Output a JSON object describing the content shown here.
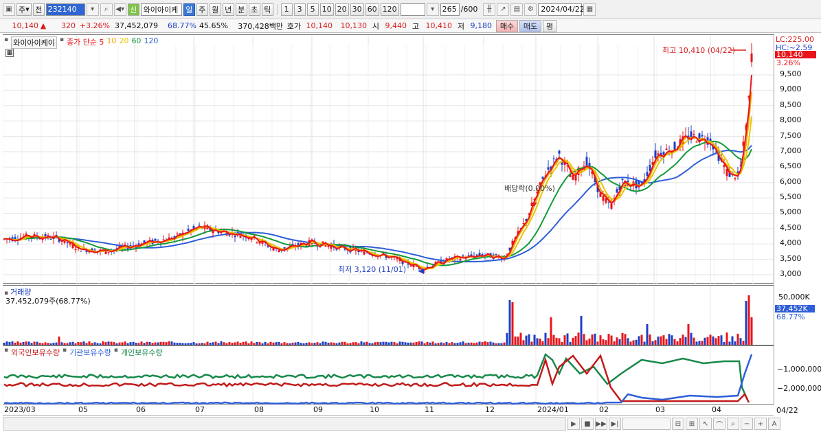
{
  "toolbar": {
    "market_labels": [
      "주",
      "전"
    ],
    "code": "232140",
    "stock_name": "와이아이케",
    "new_badge": "신",
    "periods": [
      "일",
      "주",
      "월",
      "년",
      "분",
      "초",
      "틱"
    ],
    "selected_period": "일",
    "intervals": [
      "1",
      "3",
      "5",
      "10",
      "20",
      "30",
      "60",
      "120"
    ],
    "count": "265",
    "count_total": "/600",
    "date": "2024/04/22"
  },
  "quote": {
    "price": "10,140",
    "arrow": "▲",
    "change": "320",
    "change_pct": "+3.26%",
    "volume": "37,452,079",
    "vol_ratio": "68.77%",
    "turnover": "45.65%",
    "amount": "370,428백만",
    "hoga_label": "호가",
    "ask": "10,140",
    "bid": "10,130",
    "open_label": "시",
    "open": "9,440",
    "high_label": "고",
    "high": "10,410",
    "low_label": "저",
    "low": "9,180",
    "buy": "매수",
    "sell": "매도",
    "eval": "평"
  },
  "price_panel": {
    "name": "와이아이케이",
    "legend": [
      {
        "label": "종가 단순 5",
        "color": "#e8141a"
      },
      {
        "label": "10",
        "color": "#f0a400"
      },
      {
        "label": "20",
        "color": "#e8c400"
      },
      {
        "label": "60",
        "color": "#129a3a"
      },
      {
        "label": "120",
        "color": "#2e5ed8"
      }
    ],
    "high_annotation": "최고 10,410 (04/22)",
    "low_annotation": "최저 3,120 (11/01)",
    "dividend_annotation": "배당락(0.00%)",
    "axis_top": "LC:225.00",
    "axis_top2": "HC:~2.59",
    "price_tag": "10,140",
    "pct_tag": "3.26%",
    "y_ticks": [
      "9,500",
      "9,000",
      "8,500",
      "8,000",
      "7,500",
      "7,000",
      "6,500",
      "6,000",
      "5,500",
      "5,000",
      "4,500",
      "4,000",
      "3,500",
      "3,000"
    ]
  },
  "volume_panel": {
    "title": "거래량",
    "value": "37,452,079주(68.77%)",
    "axis_tag": "37,452K",
    "axis_tag2": "68.77%",
    "y_tick": "50,000K"
  },
  "holding_panel": {
    "legend": [
      {
        "label": "외국인보유수량",
        "color": "#c21a1a"
      },
      {
        "label": "기관보유수량",
        "color": "#2e5ed8"
      },
      {
        "label": "개인보유수량",
        "color": "#17884a"
      }
    ],
    "y_ticks": [
      "−1,000,000",
      "−2,000,000"
    ]
  },
  "x_axis": [
    "2023/03",
    "05",
    "06",
    "07",
    "08",
    "09",
    "10",
    "11",
    "12",
    "2024/01",
    "02",
    "03",
    "04"
  ],
  "x_axis_end": "04/22",
  "colors": {
    "up": "#e8141a",
    "down": "#1d3fc4",
    "ma5": "#e8141a",
    "ma10": "#f0a400",
    "ma20": "#e8c400",
    "ma60": "#129a3a",
    "ma120": "#2e5ed8"
  }
}
